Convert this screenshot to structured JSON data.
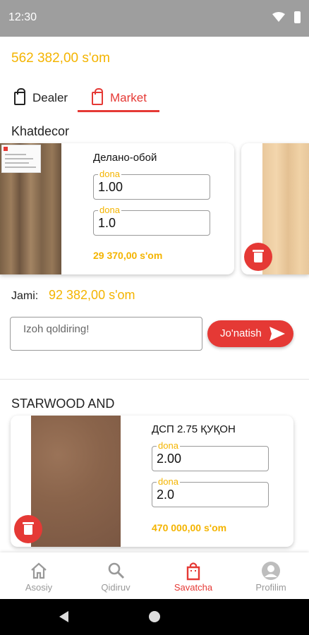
{
  "status_bar": {
    "time": "12:30"
  },
  "header": {
    "total": "562 382,00 s'om"
  },
  "tabs": [
    {
      "label": "Dealer",
      "active": false
    },
    {
      "label": "Market",
      "active": true
    }
  ],
  "shops": [
    {
      "name": "Khatdecor",
      "products": [
        {
          "title": "Делано-обой",
          "field1": {
            "label": "dona",
            "value": "1.00"
          },
          "field2": {
            "label": "dona",
            "value": "1.0"
          },
          "price": "29 370,00 s'om"
        }
      ],
      "total_label": "Jami:",
      "total_value": "92 382,00 s'om",
      "comment_placeholder": "Izoh qoldiring!",
      "send_label": "Jo'natish"
    },
    {
      "name": "STARWOOD AND",
      "products": [
        {
          "title": "ДСП 2.75 ҚУҚОН",
          "field1": {
            "label": "dona",
            "value": "2.00"
          },
          "field2": {
            "label": "dona",
            "value": "2.0"
          },
          "price": "470 000,00 s'om"
        }
      ]
    }
  ],
  "bottom_nav": [
    {
      "label": "Asosiy",
      "icon": "home-icon",
      "active": false
    },
    {
      "label": "Qidiruv",
      "icon": "search-icon",
      "active": false
    },
    {
      "label": "Savatcha",
      "icon": "shopping-bag-icon",
      "active": true
    },
    {
      "label": "Profilim",
      "icon": "profile-icon",
      "active": false
    }
  ],
  "colors": {
    "accent": "#e53935",
    "price": "#f4b400",
    "status_bar": "#9e9e9e"
  }
}
